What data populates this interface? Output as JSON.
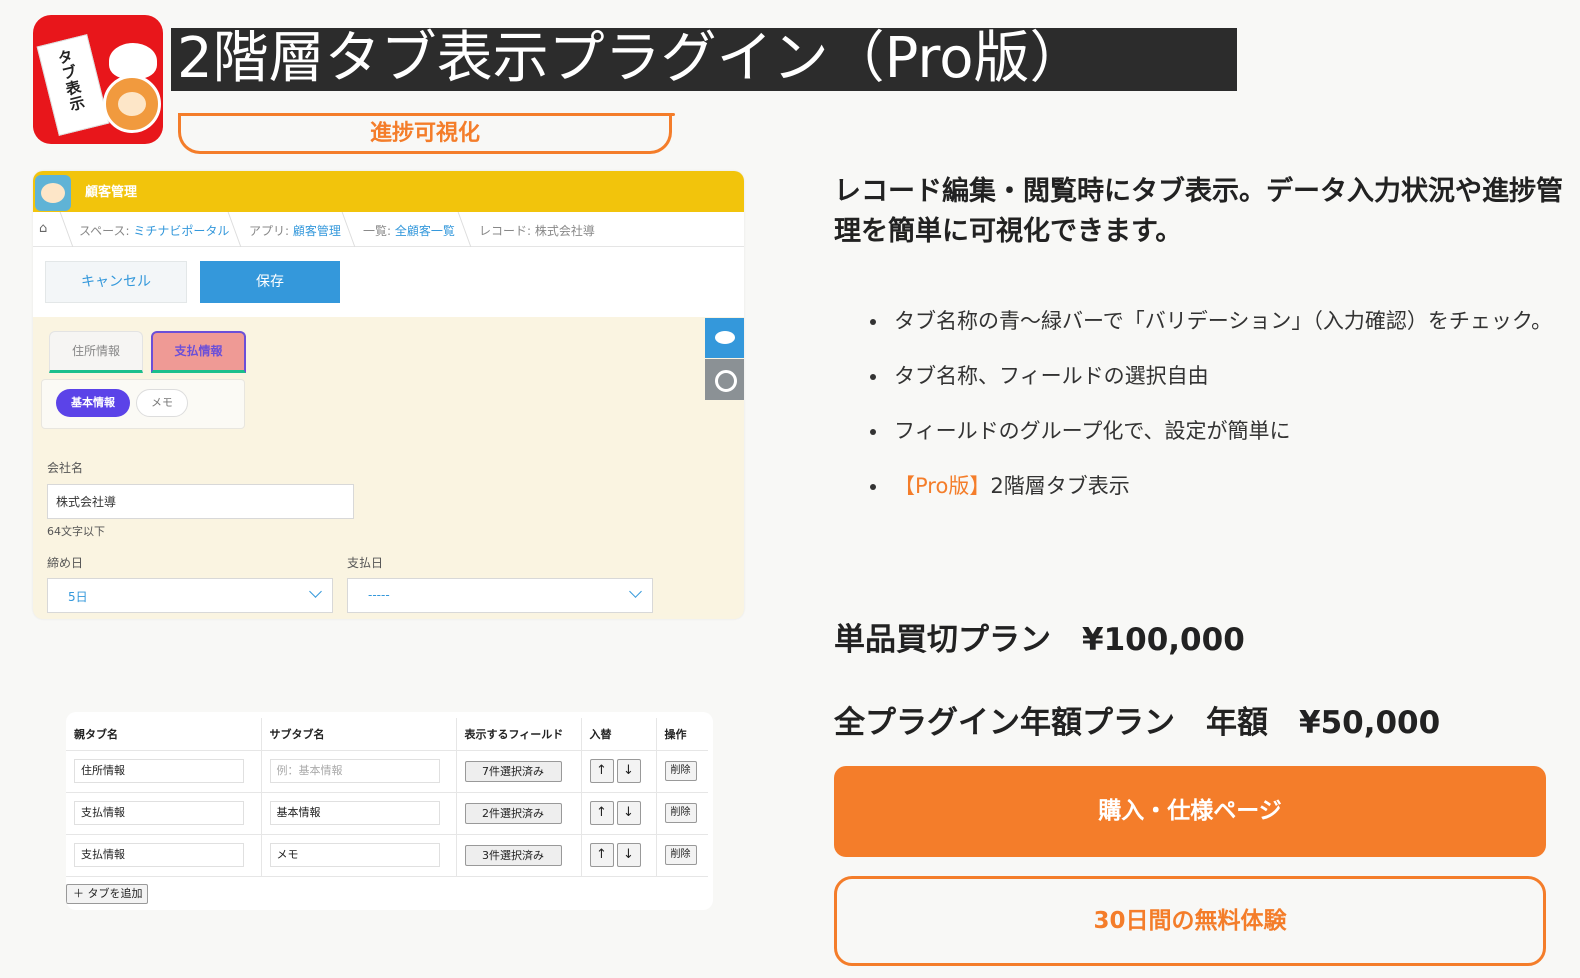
{
  "header": {
    "logo_text": "タブ表示",
    "title": "2階層タブ表示プラグイン（Pro版）",
    "tag": "進捗可視化"
  },
  "screenshot1": {
    "app_title": "顧客管理",
    "breadcrumb": [
      {
        "label": "スペース: ",
        "link": "ミチナビポータル"
      },
      {
        "label": "アプリ: ",
        "link": "顧客管理"
      },
      {
        "label": "一覧: ",
        "link": "全顧客一覧"
      },
      {
        "label": "レコード: 株式会社導",
        "link": ""
      }
    ],
    "cancel_label": "キャンセル",
    "save_label": "保存",
    "tabs": [
      "住所情報",
      "支払情報"
    ],
    "subtabs": [
      "基本情報",
      "メモ"
    ],
    "field_company_label": "会社名",
    "field_company_value": "株式会社導",
    "field_company_hint": "64文字以下",
    "field_close_label": "締め日",
    "field_close_value": "5日",
    "field_pay_label": "支払日",
    "field_pay_value": "-----"
  },
  "screenshot2": {
    "headers": [
      "親タブ名",
      "サブタブ名",
      "表示するフィールド",
      "入替",
      "操作"
    ],
    "rows": [
      {
        "parent": "住所情報",
        "sub": "例：基本情報",
        "sub_placeholder": true,
        "fields": "7件選択済み"
      },
      {
        "parent": "支払情報",
        "sub": "基本情報",
        "sub_placeholder": false,
        "fields": "2件選択済み"
      },
      {
        "parent": "支払情報",
        "sub": "メモ",
        "sub_placeholder": false,
        "fields": "3件選択済み"
      }
    ],
    "up_label": "↑",
    "down_label": "↓",
    "delete_label": "削除",
    "add_tab_label": "＋ タブを追加"
  },
  "right": {
    "headline": "レコード編集・閲覧時にタブ表示。データ入力状況や進捗管理を簡単に可視化できます。",
    "features": [
      "タブ名称の青〜緑バーで「バリデーション」（入力確認）をチェック。",
      "タブ名称、フィールドの選択自由",
      "フィールドのグループ化で、設定が簡単に"
    ],
    "feature_pro_prefix": "【Pro版】",
    "feature_pro_text": "2階層タブ表示",
    "price_single": "単品買切プラン　¥100,000",
    "price_annual": "全プラグイン年額プラン　年額　¥50,000",
    "buy_label": "購入・仕様ページ",
    "trial_label": "30日間の無料体験"
  },
  "colors": {
    "accent": "#f47d2a",
    "title_bg": "#2c2c2c",
    "logo_bg": "#e8161b",
    "kintone_header": "#f2c40c",
    "kintone_blue": "#3498db"
  }
}
